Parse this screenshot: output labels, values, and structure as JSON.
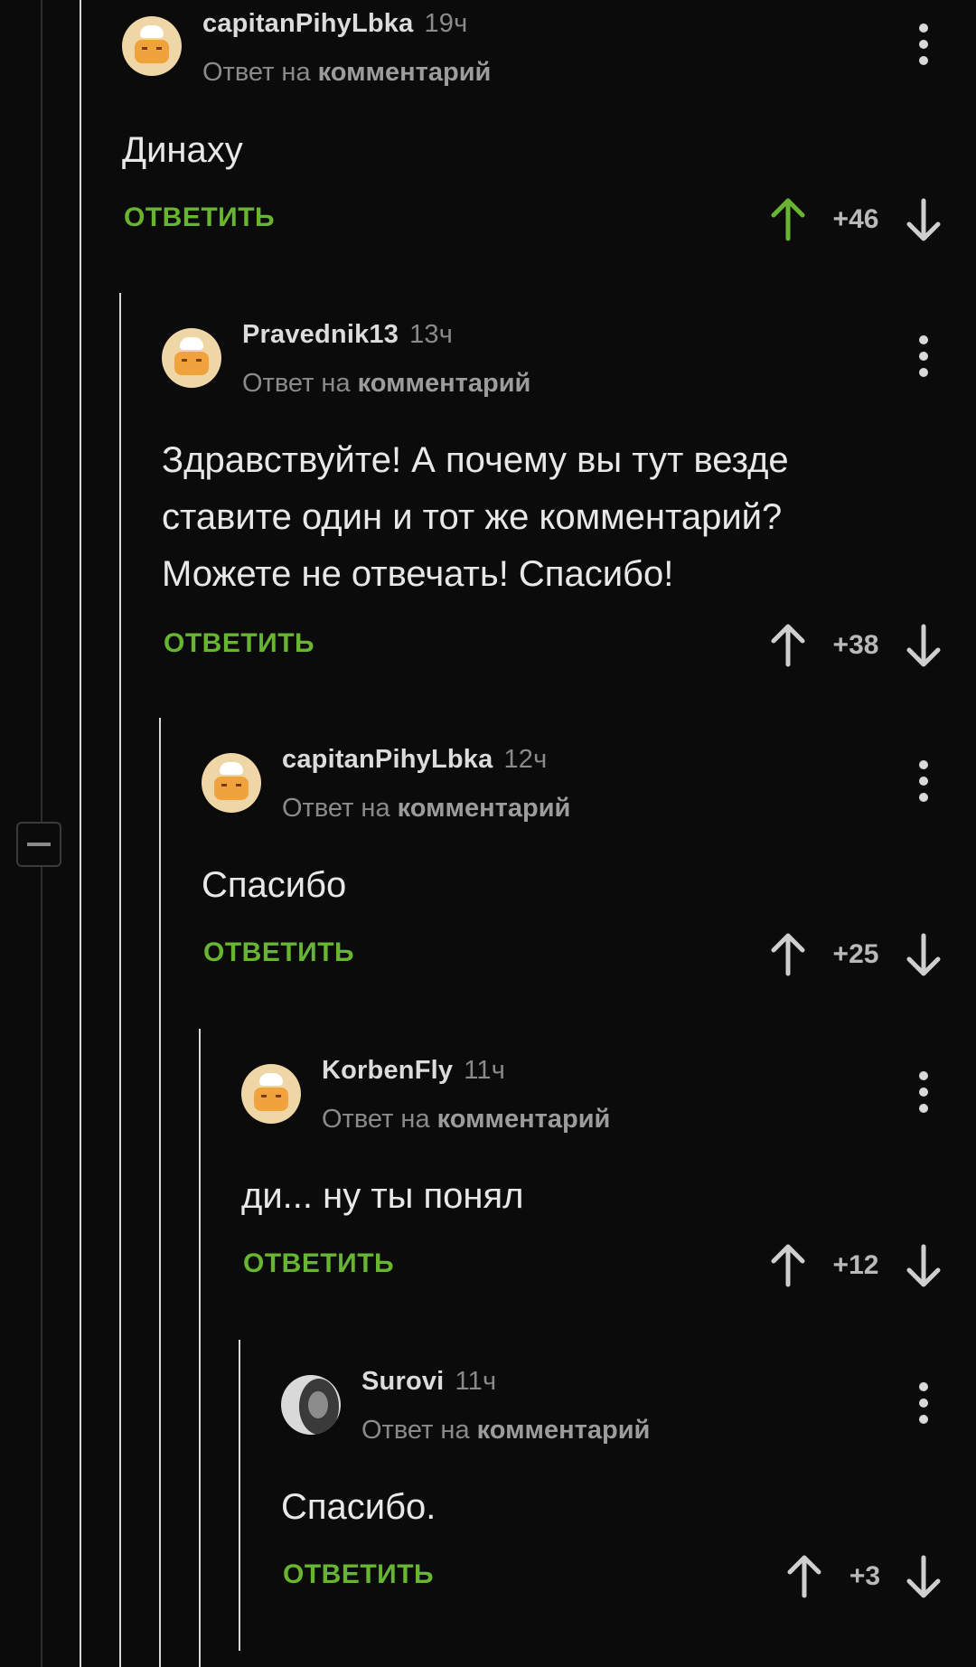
{
  "comments": [
    {
      "author": "capitanPihyLbka",
      "time": "19ч",
      "reply_prefix": "Ответ на",
      "reply_target": "комментарий",
      "text": "Динаху",
      "reply_label": "ОТВЕТИТЬ",
      "score": "+46",
      "upvoted": true,
      "avatar": "chef-avatar"
    },
    {
      "author": "Pravednik13",
      "time": "13ч",
      "reply_prefix": "Ответ на",
      "reply_target": "комментарий",
      "text": "Здравствуйте! А почему вы тут везде ставите один и тот же комментарий? Можете не отвечать! Спасибо!",
      "reply_label": "ОТВЕТИТЬ",
      "score": "+38",
      "upvoted": false,
      "avatar": "chef-avatar"
    },
    {
      "author": "capitanPihyLbka",
      "time": "12ч",
      "reply_prefix": "Ответ на",
      "reply_target": "комментарий",
      "text": "Спасибо",
      "reply_label": "ОТВЕТИТЬ",
      "score": "+25",
      "upvoted": false,
      "avatar": "chef-avatar"
    },
    {
      "author": "KorbenFly",
      "time": "11ч",
      "reply_prefix": "Ответ на",
      "reply_target": "комментарий",
      "text": "ди... ну ты понял",
      "reply_label": "ОТВЕТИТЬ",
      "score": "+12",
      "upvoted": false,
      "avatar": "chef-avatar"
    },
    {
      "author": "Surovi",
      "time": "11ч",
      "reply_prefix": "Ответ на",
      "reply_target": "комментарий",
      "text": "Спасибо.",
      "reply_label": "ОТВЕТИТЬ",
      "score": "+3",
      "upvoted": false,
      "avatar": "photo-avatar"
    }
  ],
  "colors": {
    "background": "#0b0b0b",
    "accent_green": "#67b530",
    "thread_line": "#d9d9d9",
    "muted_text": "#8a8a8a"
  },
  "icons": {
    "upvote": "arrow-up-icon",
    "downvote": "arrow-down-icon",
    "menu": "kebab-menu-icon",
    "collapse": "minus-icon"
  }
}
